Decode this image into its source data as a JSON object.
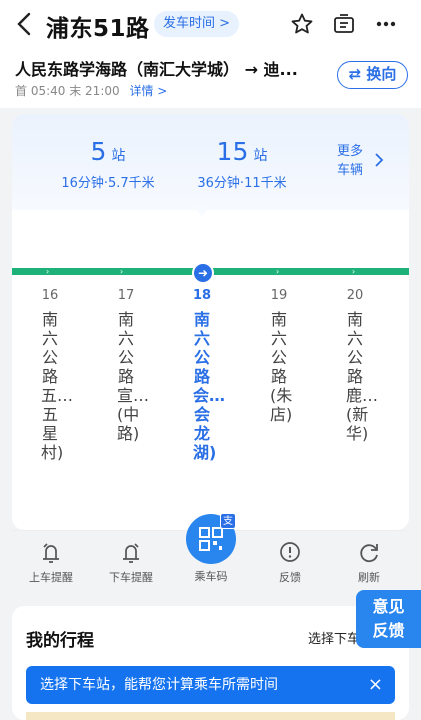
{
  "header": {
    "title": "浦东51路",
    "depart_time_label": "发车时间",
    "depart_chevron": ">"
  },
  "direction": {
    "text": "人民东路学海路（南汇大学城） → 迪...",
    "first_label": "首 05:40",
    "last_label": "末 21:00",
    "detail_label": "详情 >",
    "switch_label": "⇄ 换向"
  },
  "eta": [
    {
      "num": "5",
      "unit": "站",
      "sub": "16分钟·5.7千米"
    },
    {
      "num": "15",
      "unit": "站",
      "sub": "36分钟·11千米"
    }
  ],
  "more_bus": {
    "line1": "更多",
    "line2": "车辆"
  },
  "stops": [
    {
      "seq": "16",
      "name": "南六公路五…五星村)"
    },
    {
      "seq": "17",
      "name": "南六公路宣…(中路)"
    },
    {
      "seq": "18",
      "name": "南六公路会…会龙湖)"
    },
    {
      "seq": "19",
      "name": "南六公路(朱店)"
    },
    {
      "seq": "20",
      "name": "南六公路鹿…(新华)"
    }
  ],
  "tools": [
    {
      "label": "上车提醒",
      "icon": "bell-up-icon"
    },
    {
      "label": "下车提醒",
      "icon": "bell-down-icon"
    },
    {
      "label": "乘车码",
      "icon": "qr-code-icon"
    },
    {
      "label": "反馈",
      "icon": "alert-icon"
    },
    {
      "label": "刷新",
      "icon": "refresh-icon"
    }
  ],
  "qr_badge": "支",
  "trip": {
    "title": "我的行程",
    "select_label": "选择下车站"
  },
  "toast": {
    "text": "选择下车站，能帮您计算乘车所需时间",
    "close": "×"
  },
  "feedback": {
    "line1": "意见",
    "line2": "反馈"
  },
  "colors": {
    "accent": "#2a6fe6",
    "track": "#1fb17a",
    "toast": "#1673f0"
  }
}
